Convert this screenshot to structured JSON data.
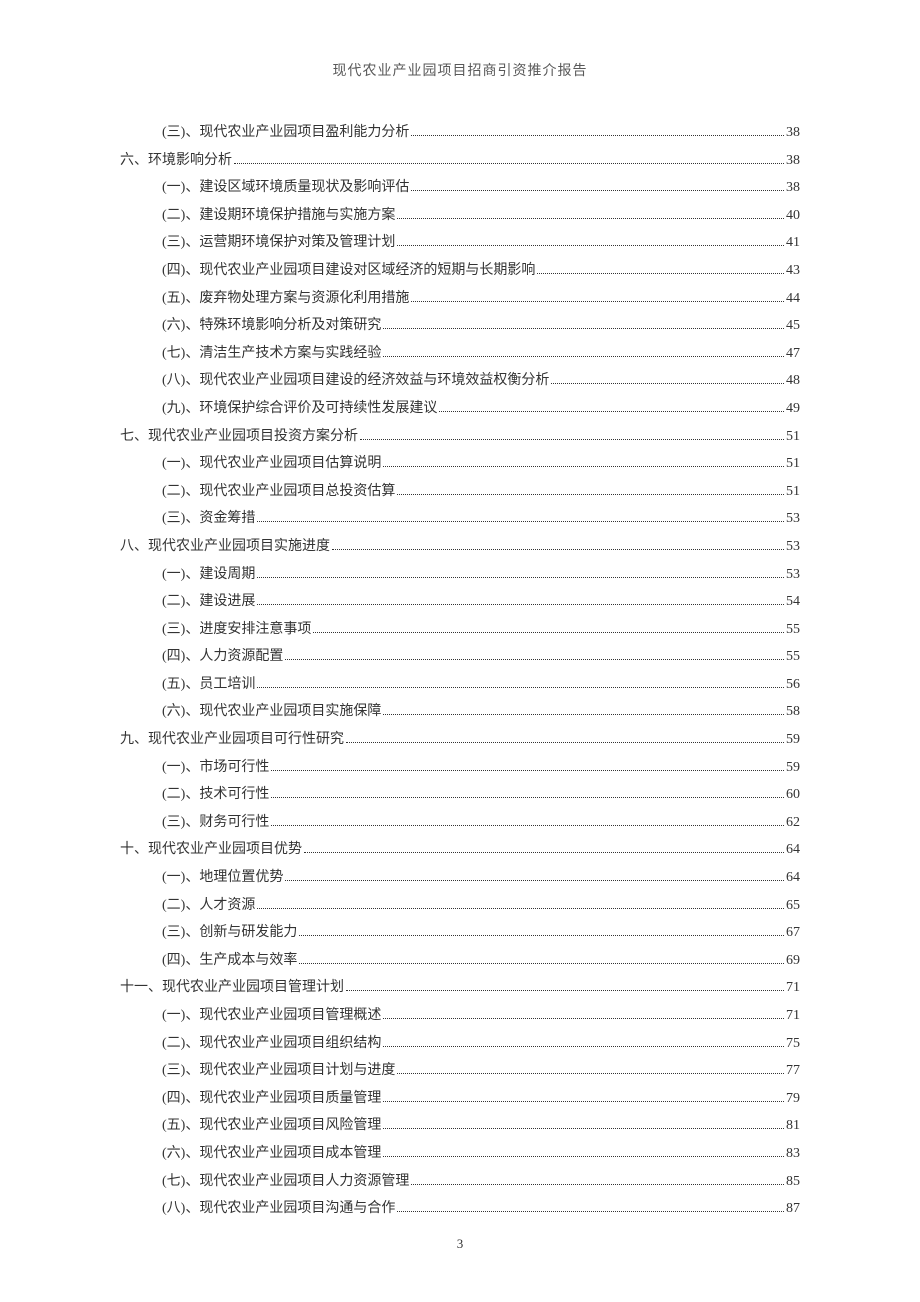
{
  "header_title": "现代农业产业园项目招商引资推介报告",
  "page_number": "3",
  "toc": [
    {
      "level": 2,
      "text": "(三)、现代农业产业园项目盈利能力分析",
      "page": "38"
    },
    {
      "level": 1,
      "text": "六、环境影响分析",
      "page": "38"
    },
    {
      "level": 2,
      "text": "(一)、建设区域环境质量现状及影响评估",
      "page": "38"
    },
    {
      "level": 2,
      "text": "(二)、建设期环境保护措施与实施方案",
      "page": "40"
    },
    {
      "level": 2,
      "text": "(三)、运营期环境保护对策及管理计划",
      "page": "41"
    },
    {
      "level": 2,
      "text": "(四)、现代农业产业园项目建设对区域经济的短期与长期影响",
      "page": "43"
    },
    {
      "level": 2,
      "text": "(五)、废弃物处理方案与资源化利用措施",
      "page": "44"
    },
    {
      "level": 2,
      "text": "(六)、特殊环境影响分析及对策研究",
      "page": "45"
    },
    {
      "level": 2,
      "text": "(七)、清洁生产技术方案与实践经验",
      "page": "47"
    },
    {
      "level": 2,
      "text": "(八)、现代农业产业园项目建设的经济效益与环境效益权衡分析",
      "page": "48"
    },
    {
      "level": 2,
      "text": "(九)、环境保护综合评价及可持续性发展建议",
      "page": "49"
    },
    {
      "level": 1,
      "text": "七、现代农业产业园项目投资方案分析",
      "page": "51"
    },
    {
      "level": 2,
      "text": "(一)、现代农业产业园项目估算说明",
      "page": "51"
    },
    {
      "level": 2,
      "text": "(二)、现代农业产业园项目总投资估算",
      "page": "51"
    },
    {
      "level": 2,
      "text": "(三)、资金筹措",
      "page": "53"
    },
    {
      "level": 1,
      "text": "八、现代农业产业园项目实施进度",
      "page": "53"
    },
    {
      "level": 2,
      "text": "(一)、建设周期",
      "page": "53"
    },
    {
      "level": 2,
      "text": "(二)、建设进展",
      "page": "54"
    },
    {
      "level": 2,
      "text": "(三)、进度安排注意事项",
      "page": "55"
    },
    {
      "level": 2,
      "text": "(四)、人力资源配置",
      "page": "55"
    },
    {
      "level": 2,
      "text": "(五)、员工培训",
      "page": "56"
    },
    {
      "level": 2,
      "text": "(六)、现代农业产业园项目实施保障",
      "page": "58"
    },
    {
      "level": 1,
      "text": "九、现代农业产业园项目可行性研究",
      "page": "59"
    },
    {
      "level": 2,
      "text": "(一)、市场可行性",
      "page": "59"
    },
    {
      "level": 2,
      "text": "(二)、技术可行性",
      "page": "60"
    },
    {
      "level": 2,
      "text": "(三)、财务可行性",
      "page": "62"
    },
    {
      "level": 1,
      "text": "十、现代农业产业园项目优势",
      "page": "64"
    },
    {
      "level": 2,
      "text": "(一)、地理位置优势",
      "page": "64"
    },
    {
      "level": 2,
      "text": "(二)、人才资源",
      "page": "65"
    },
    {
      "level": 2,
      "text": "(三)、创新与研发能力",
      "page": "67"
    },
    {
      "level": 2,
      "text": "(四)、生产成本与效率",
      "page": "69"
    },
    {
      "level": 1,
      "text": "十一、现代农业产业园项目管理计划",
      "page": "71"
    },
    {
      "level": 2,
      "text": "(一)、现代农业产业园项目管理概述",
      "page": "71"
    },
    {
      "level": 2,
      "text": "(二)、现代农业产业园项目组织结构",
      "page": "75"
    },
    {
      "level": 2,
      "text": "(三)、现代农业产业园项目计划与进度",
      "page": "77"
    },
    {
      "level": 2,
      "text": "(四)、现代农业产业园项目质量管理",
      "page": "79"
    },
    {
      "level": 2,
      "text": "(五)、现代农业产业园项目风险管理",
      "page": "81"
    },
    {
      "level": 2,
      "text": "(六)、现代农业产业园项目成本管理",
      "page": "83"
    },
    {
      "level": 2,
      "text": "(七)、现代农业产业园项目人力资源管理",
      "page": "85"
    },
    {
      "level": 2,
      "text": "(八)、现代农业产业园项目沟通与合作",
      "page": "87"
    }
  ]
}
